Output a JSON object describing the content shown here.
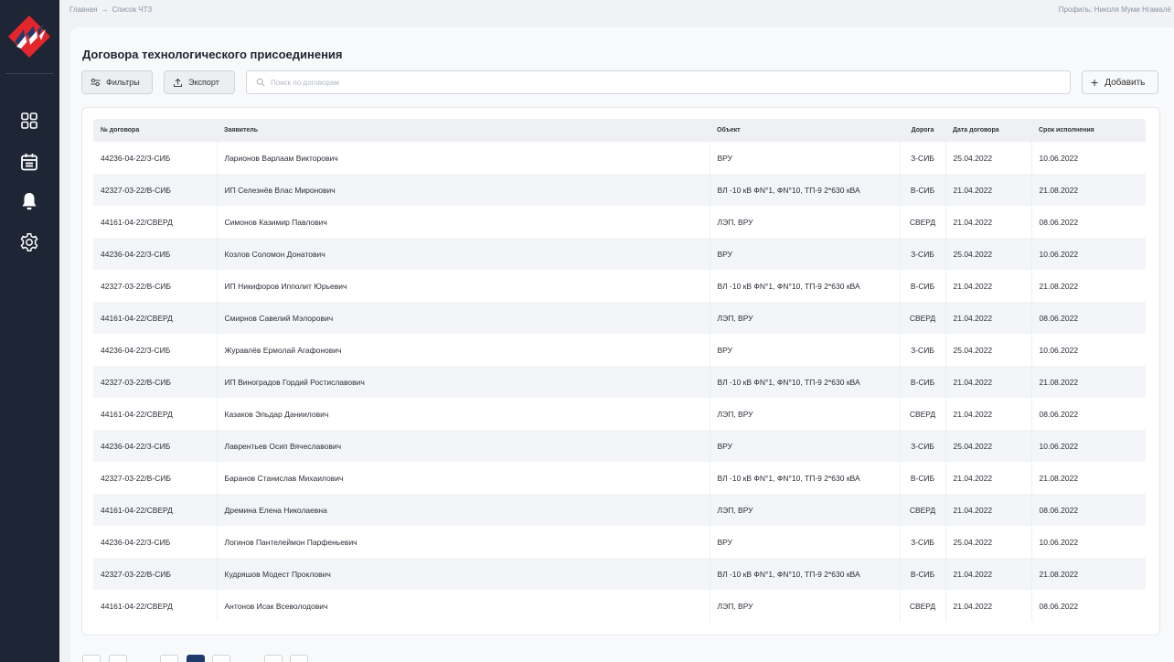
{
  "colors": {
    "sidebar_bg": "#1e2636",
    "logo_red": "#e3262c",
    "logo_blue": "#1f3a6b",
    "pager_active": "#1f3a6b"
  },
  "sidebar": {
    "items": [
      {
        "icon": "dashboard-grid-icon"
      },
      {
        "icon": "calendar-icon"
      },
      {
        "icon": "bell-icon"
      },
      {
        "icon": "gear-icon"
      }
    ]
  },
  "breadcrumb": {
    "home": "Главная",
    "separator": "→",
    "current": "Список ЧТЗ"
  },
  "profile": "Профиль: Николя Муми Нгамалё",
  "page_title": "Договора технологического присоединения",
  "toolbar": {
    "filters_label": "Фильтры",
    "export_label": "Экспорт",
    "search_placeholder": "Поиск по договорам",
    "add_label": "Добавить"
  },
  "table": {
    "headers": {
      "number": "№ договора",
      "applicant": "Заявитель",
      "object": "Объект",
      "road": "Дорога",
      "date": "Дата договора",
      "deadline": "Срок исполнения"
    },
    "rows": [
      {
        "number": "44236-04-22/З-СИБ",
        "applicant": "Ларионов Варлаам Викторович",
        "object": "ВРУ",
        "road": "З-СИБ",
        "date": "25.04.2022",
        "deadline": "10.06.2022"
      },
      {
        "number": "42327-03-22/В-СИБ",
        "applicant": "ИП Селезнёв Влас Миронович",
        "object": "ВЛ -10 кВ ФN°1, ФN°10, ТП-9 2*630 кВА",
        "road": "В-СИБ",
        "date": "21.04.2022",
        "deadline": "21.08.2022"
      },
      {
        "number": "44161-04-22/СВЕРД",
        "applicant": "Симонов Казимир Павлович",
        "object": "ЛЭП, ВРУ",
        "road": "СВЕРД",
        "date": "21.04.2022",
        "deadline": "08.06.2022"
      },
      {
        "number": "44236-04-22/З-СИБ",
        "applicant": "Козлов Соломон Донатович",
        "object": "ВРУ",
        "road": "З-СИБ",
        "date": "25.04.2022",
        "deadline": "10.06.2022"
      },
      {
        "number": "42327-03-22/В-СИБ",
        "applicant": "ИП Никифоров Ипполит Юрьевич",
        "object": "ВЛ -10 кВ ФN°1, ФN°10, ТП-9 2*630 кВА",
        "road": "В-СИБ",
        "date": "21.04.2022",
        "deadline": "21.08.2022"
      },
      {
        "number": "44161-04-22/СВЕРД",
        "applicant": "Смирнов Савелий Мэлорович",
        "object": "ЛЭП, ВРУ",
        "road": "СВЕРД",
        "date": "21.04.2022",
        "deadline": "08.06.2022"
      },
      {
        "number": "44236-04-22/З-СИБ",
        "applicant": "Журавлёв Ермолай Агафонович",
        "object": "ВРУ",
        "road": "З-СИБ",
        "date": "25.04.2022",
        "deadline": "10.06.2022"
      },
      {
        "number": "42327-03-22/В-СИБ",
        "applicant": "ИП Виноградов Гордий Ростиславович",
        "object": "ВЛ -10 кВ ФN°1, ФN°10, ТП-9 2*630 кВА",
        "road": "В-СИБ",
        "date": "21.04.2022",
        "deadline": "21.08.2022"
      },
      {
        "number": "44161-04-22/СВЕРД",
        "applicant": "Казаков Эльдар Даниилович",
        "object": "ЛЭП, ВРУ",
        "road": "СВЕРД",
        "date": "21.04.2022",
        "deadline": "08.06.2022"
      },
      {
        "number": "44236-04-22/З-СИБ",
        "applicant": "Лаврентьев Осип Вячеславович",
        "object": "ВРУ",
        "road": "З-СИБ",
        "date": "25.04.2022",
        "deadline": "10.06.2022"
      },
      {
        "number": "42327-03-22/В-СИБ",
        "applicant": "Баранов Станислав Михаилович",
        "object": "ВЛ -10 кВ ФN°1, ФN°10, ТП-9 2*630 кВА",
        "road": "В-СИБ",
        "date": "21.04.2022",
        "deadline": "21.08.2022"
      },
      {
        "number": "44161-04-22/СВЕРД",
        "applicant": "Дремина Елена Николаевна",
        "object": "ЛЭП, ВРУ",
        "road": "СВЕРД",
        "date": "21.04.2022",
        "deadline": "08.06.2022"
      },
      {
        "number": "44236-04-22/З-СИБ",
        "applicant": "Логинов Пантелеймон Парфеньевич",
        "object": "ВРУ",
        "road": "З-СИБ",
        "date": "25.04.2022",
        "deadline": "10.06.2022"
      },
      {
        "number": "42327-03-22/В-СИБ",
        "applicant": "Кудряшов Модест Проклович",
        "object": "ВЛ -10 кВ ФN°1, ФN°10, ТП-9 2*630 кВА",
        "road": "В-СИБ",
        "date": "21.04.2022",
        "deadline": "21.08.2022"
      },
      {
        "number": "44161-04-22/СВЕРД",
        "applicant": "Антонов Исак Всеволодович",
        "object": "ЛЭП, ВРУ",
        "road": "СВЕРД",
        "date": "21.04.2022",
        "deadline": "08.06.2022"
      }
    ]
  }
}
